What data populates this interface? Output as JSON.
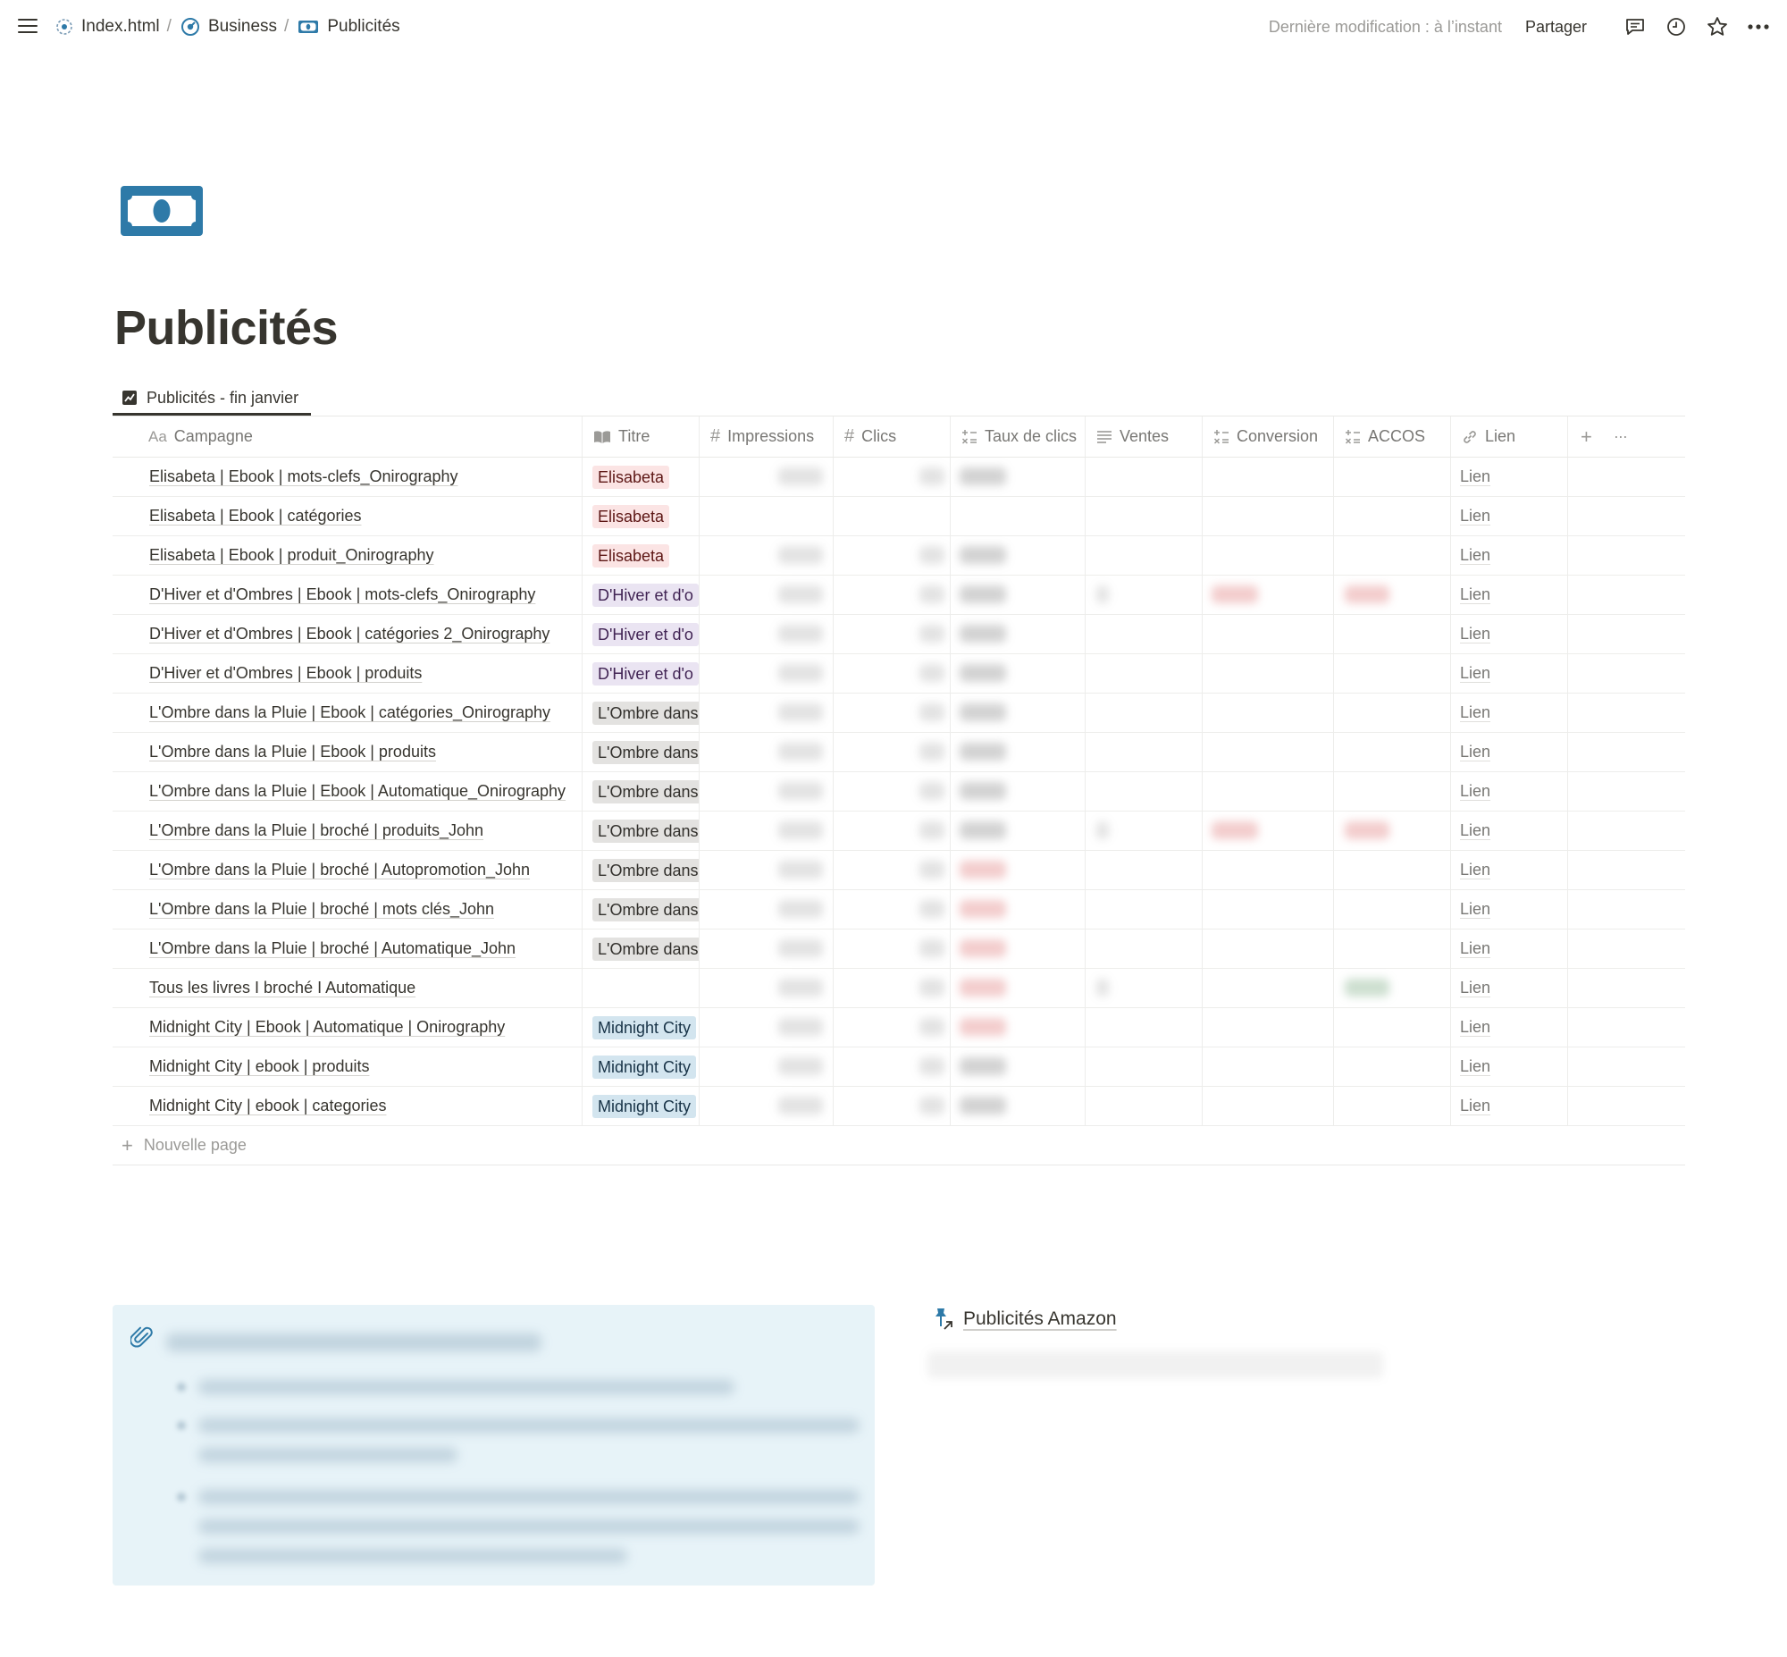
{
  "topbar": {
    "breadcrumb": [
      {
        "label": "Index.html",
        "icon": "target-icon"
      },
      {
        "label": "Business",
        "icon": "gauge-icon"
      },
      {
        "label": "Publicités",
        "icon": "banknote-icon"
      }
    ],
    "separator": "/",
    "last_edited": "Dernière modification : à l’instant",
    "share": "Partager",
    "icons": [
      "comment-icon",
      "history-icon",
      "star-icon",
      "more-icon"
    ]
  },
  "page": {
    "icon": "banknote-icon",
    "icon_color": "#2e7aa8",
    "title": "Publicités"
  },
  "view": {
    "tab_label": "Publicités - fin janvier",
    "tab_icon": "chart-icon"
  },
  "table": {
    "columns": {
      "campagne": "Campagne",
      "titre": "Titre",
      "impressions": "Impressions",
      "clics": "Clics",
      "taux": "Taux de clics",
      "ventes": "Ventes",
      "conversion": "Conversion",
      "accos": "ACCOS",
      "lien": "Lien"
    },
    "title_prefix_icon_text": "Aa",
    "add_column": "+",
    "more_options": "···",
    "rows": [
      {
        "campagne": "Elisabeta | Ebook | mots-clefs_Onirography",
        "titre": "Elisabeta",
        "tag": "red",
        "lien": "Lien"
      },
      {
        "campagne": "Elisabeta | Ebook | catégories",
        "titre": "Elisabeta",
        "tag": "red",
        "lien": "Lien"
      },
      {
        "campagne": "Elisabeta | Ebook | produit_Onirography",
        "titre": "Elisabeta",
        "tag": "red",
        "lien": "Lien"
      },
      {
        "campagne": "D'Hiver et d'Ombres | Ebook | mots-clefs_Onirography",
        "titre": "D'Hiver et d'o",
        "tag": "purple",
        "lien": "Lien"
      },
      {
        "campagne": "D'Hiver et d'Ombres | Ebook | catégories 2_Onirography",
        "titre": "D'Hiver et d'o",
        "tag": "purple",
        "lien": "Lien"
      },
      {
        "campagne": "D'Hiver et d'Ombres | Ebook | produits",
        "titre": "D'Hiver et d'o",
        "tag": "purple",
        "lien": "Lien"
      },
      {
        "campagne": "L'Ombre dans la Pluie | Ebook | catégories_Onirography",
        "titre": "L'Ombre dans",
        "tag": "gray",
        "lien": "Lien"
      },
      {
        "campagne": "L'Ombre dans la Pluie | Ebook | produits",
        "titre": "L'Ombre dans",
        "tag": "gray",
        "lien": "Lien"
      },
      {
        "campagne": "L'Ombre dans la Pluie | Ebook | Automatique_Onirography",
        "titre": "L'Ombre dans",
        "tag": "gray",
        "lien": "Lien"
      },
      {
        "campagne": "L'Ombre dans la Pluie | broché | produits_John",
        "titre": "L'Ombre dans",
        "tag": "gray",
        "lien": "Lien"
      },
      {
        "campagne": "L'Ombre dans la Pluie | broché | Autopromotion_John",
        "titre": "L'Ombre dans",
        "tag": "gray",
        "lien": "Lien"
      },
      {
        "campagne": "L'Ombre dans la Pluie | broché | mots clés_John",
        "titre": "L'Ombre dans",
        "tag": "gray",
        "lien": "Lien"
      },
      {
        "campagne": "L'Ombre dans la Pluie | broché | Automatique_John",
        "titre": "L'Ombre dans",
        "tag": "gray",
        "lien": "Lien"
      },
      {
        "campagne": "Tous les livres I broché I Automatique",
        "titre": "",
        "tag": "",
        "lien": "Lien"
      },
      {
        "campagne": "Midnight City | Ebook | Automatique | Onirography",
        "titre": "Midnight City",
        "tag": "blue",
        "lien": "Lien"
      },
      {
        "campagne": "Midnight City | ebook | produits",
        "titre": "Midnight City",
        "tag": "blue",
        "lien": "Lien"
      },
      {
        "campagne": "Midnight City | ebook | categories",
        "titre": "Midnight City",
        "tag": "blue",
        "lien": "Lien"
      }
    ],
    "new_page": "Nouvelle page"
  },
  "callout": {
    "icon": "paperclip-icon",
    "background": "#e7f3f8"
  },
  "linked_page": {
    "icon": "pin-link-icon",
    "label": "Publicités Amazon"
  }
}
